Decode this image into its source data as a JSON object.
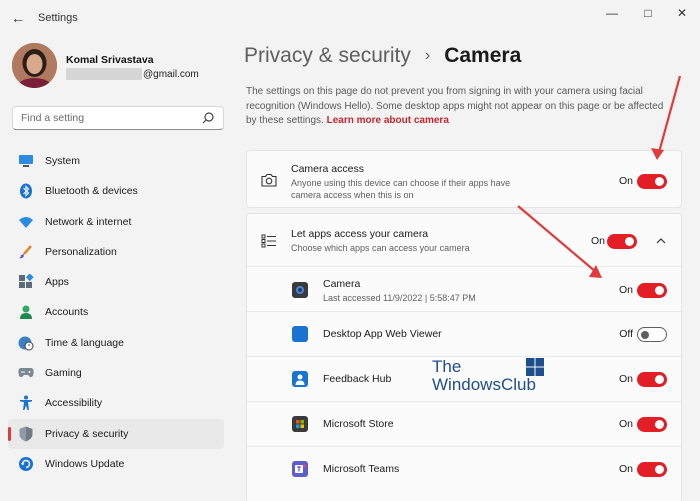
{
  "window": {
    "title": "Settings",
    "back_glyph": "←",
    "minimize_glyph": "—",
    "maximize_glyph": "□",
    "close_glyph": "✕"
  },
  "profile": {
    "name": "Komal Srivastava",
    "email_suffix": "@gmail.com"
  },
  "search": {
    "placeholder": "Find a setting",
    "icon": "search-icon"
  },
  "nav": {
    "items": [
      {
        "label": "System",
        "icon": "monitor-icon",
        "active": false
      },
      {
        "label": "Bluetooth & devices",
        "icon": "bluetooth-icon",
        "active": false
      },
      {
        "label": "Network & internet",
        "icon": "wifi-icon",
        "active": false
      },
      {
        "label": "Personalization",
        "icon": "brush-icon",
        "active": false
      },
      {
        "label": "Apps",
        "icon": "apps-icon",
        "active": false
      },
      {
        "label": "Accounts",
        "icon": "person-icon",
        "active": false
      },
      {
        "label": "Time & language",
        "icon": "clock-globe-icon",
        "active": false
      },
      {
        "label": "Gaming",
        "icon": "gamepad-icon",
        "active": false
      },
      {
        "label": "Accessibility",
        "icon": "accessibility-icon",
        "active": false
      },
      {
        "label": "Privacy & security",
        "icon": "shield-icon",
        "active": true
      },
      {
        "label": "Windows Update",
        "icon": "update-icon",
        "active": false
      }
    ]
  },
  "header": {
    "parent": "Privacy & security",
    "separator": "›",
    "current": "Camera"
  },
  "info": {
    "text": "The settings on this page do not prevent you from signing in with your camera using facial recognition (Windows Hello). Some desktop apps might not appear on this page or be affected by these settings.",
    "link": "Learn more about camera"
  },
  "camera_access": {
    "title": "Camera access",
    "subtitle": "Anyone using this device can choose if their apps have camera access when this is on",
    "state": "On"
  },
  "apps_access": {
    "title": "Let apps access your camera",
    "subtitle": "Choose which apps can access your camera",
    "state": "On"
  },
  "apps": [
    {
      "name": "Camera",
      "detail": "Last accessed 11/9/2022  |  5:58:47 PM",
      "state": "On",
      "color": "#3a3a3a"
    },
    {
      "name": "Desktop App Web Viewer",
      "detail": "",
      "state": "Off",
      "color": "#1a73d1"
    },
    {
      "name": "Feedback Hub",
      "detail": "",
      "state": "On",
      "color": "#1a73d1"
    },
    {
      "name": "Microsoft Store",
      "detail": "",
      "state": "On",
      "color": "#3a3a3a"
    },
    {
      "name": "Microsoft Teams",
      "detail": "",
      "state": "On",
      "color": "#5b5fc7"
    }
  ],
  "watermark": {
    "line1": "The",
    "line2": "WindowsClub"
  },
  "colors": {
    "accent": "#e31e24",
    "link": "#c4262e"
  }
}
